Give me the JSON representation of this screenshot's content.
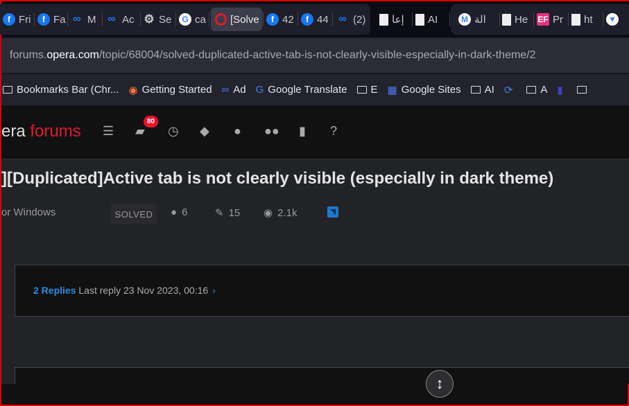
{
  "tabs": [
    {
      "icon": "facebook",
      "label": "Fri"
    },
    {
      "icon": "facebook",
      "label": "Fa"
    },
    {
      "icon": "meta",
      "label": "M"
    },
    {
      "icon": "meta",
      "label": "Ac"
    },
    {
      "icon": "gear",
      "label": "Se"
    },
    {
      "icon": "google",
      "label": "ca"
    },
    {
      "icon": "opera",
      "label": "[Solve",
      "active": true
    },
    {
      "icon": "facebook",
      "label": "42"
    },
    {
      "icon": "facebook",
      "label": "44"
    },
    {
      "icon": "meta",
      "label": "(2)"
    },
    {
      "icon": "document",
      "label": "إعا"
    },
    {
      "icon": "document",
      "label": "AI"
    },
    {
      "icon": "gmail",
      "label": "الة"
    },
    {
      "icon": "document",
      "label": "He"
    },
    {
      "icon": "ef",
      "label": "Pr"
    },
    {
      "icon": "document",
      "label": "ht"
    },
    {
      "icon": "shield",
      "label": ""
    }
  ],
  "address": {
    "prefix": "forums.",
    "domain": "opera.com",
    "path": "/topic/68004/solved-duplicated-active-tab-is-not-clearly-visible-especially-in-dark-theme/2"
  },
  "bookmarks": [
    {
      "icon": "folder",
      "label": "Bookmarks Bar (Chr..."
    },
    {
      "icon": "firefox",
      "label": "Getting Started"
    },
    {
      "icon": "meta",
      "label": "Ad"
    },
    {
      "icon": "google-translate",
      "label": "Google Translate"
    },
    {
      "icon": "folder",
      "label": "E"
    },
    {
      "icon": "google-sites",
      "label": "Google Sites"
    },
    {
      "icon": "folder",
      "label": "AI"
    },
    {
      "icon": "sync",
      "label": ""
    },
    {
      "icon": "folder",
      "label": "A"
    },
    {
      "icon": "bottle",
      "label": ""
    },
    {
      "icon": "folder",
      "label": ""
    }
  ],
  "header": {
    "logo_prefix": "era",
    "logo_suffix": "forums",
    "notification_count": "80",
    "nav": [
      "list-icon",
      "inbox-icon",
      "clock-icon",
      "tags-icon",
      "user-icon",
      "users-icon",
      "book-icon",
      "help-icon"
    ]
  },
  "topic": {
    "title": "][Duplicated]Active tab is not clearly visible (especially in dark theme)",
    "category": "or Windows",
    "status": "SOLVED",
    "posters": "6",
    "posts": "15",
    "views": "2.1k"
  },
  "replies": {
    "count": "2 Replies",
    "last": "Last reply 23 Nov 2023, 00:16",
    "chevron": "›"
  },
  "colors": {
    "accent": "#e0192d",
    "link": "#2a8ae0"
  }
}
